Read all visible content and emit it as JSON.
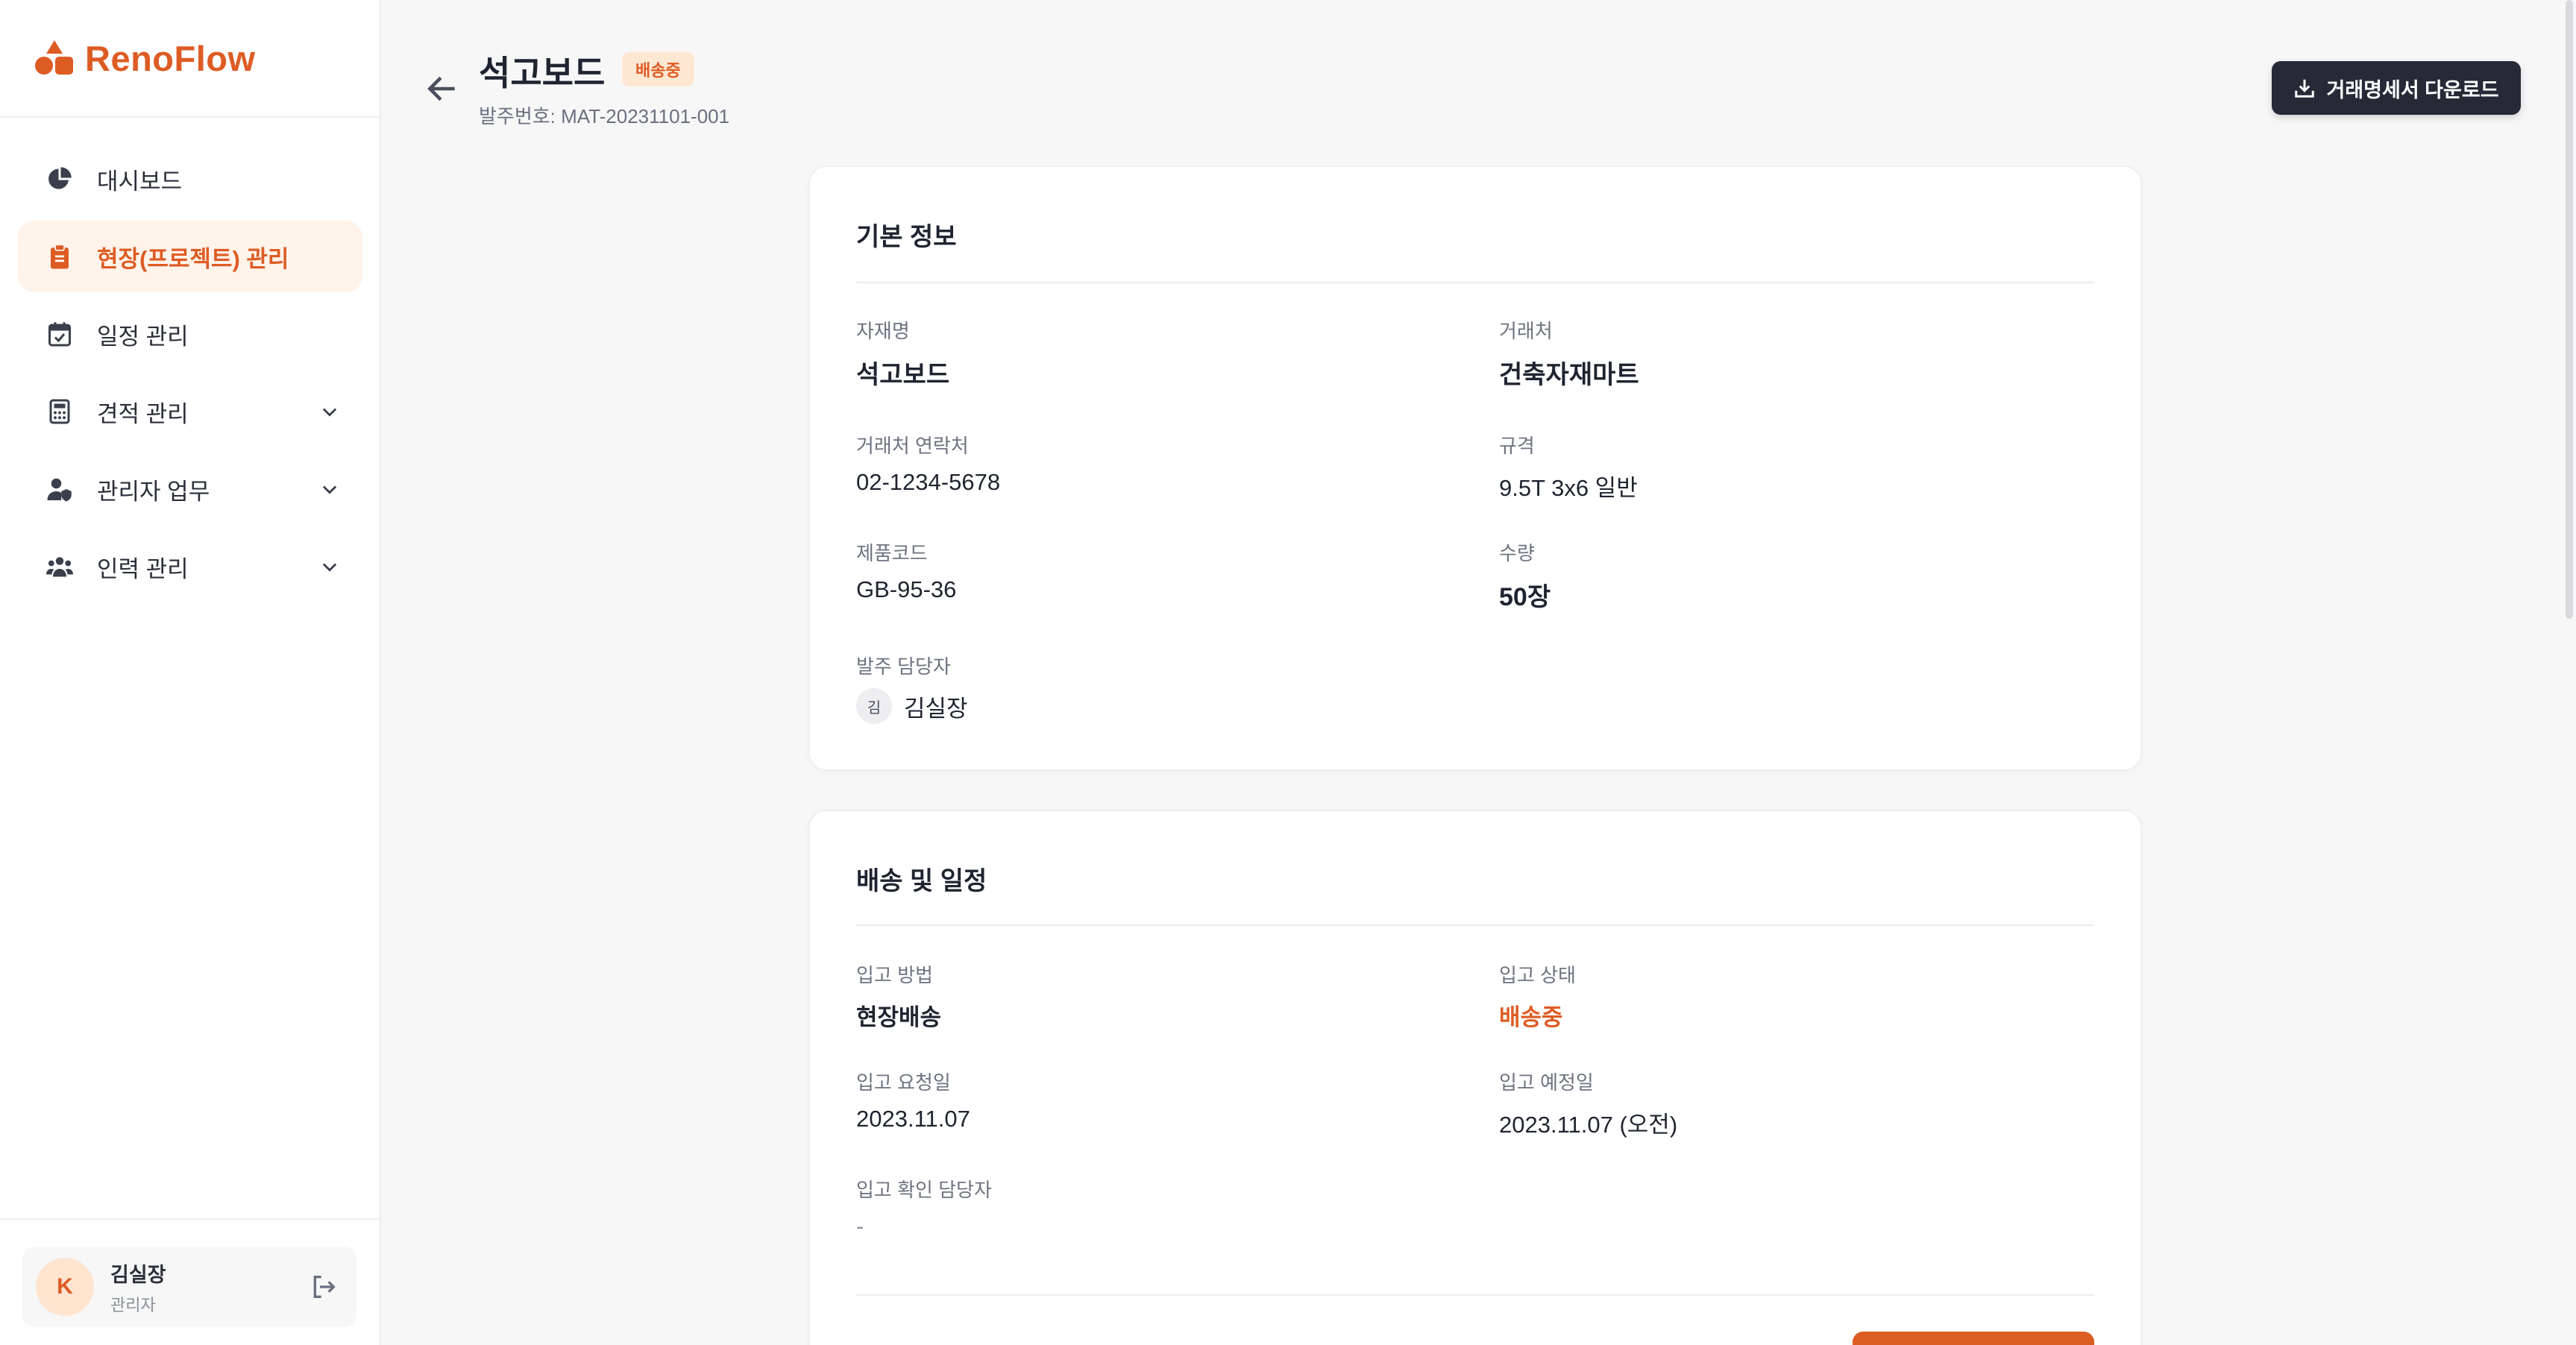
{
  "brand": {
    "name": "RenoFlow"
  },
  "nav": [
    {
      "label": "대시보드",
      "icon": "pie-chart-icon"
    },
    {
      "label": "현장(프로젝트) 관리",
      "icon": "clipboard-icon",
      "active": true
    },
    {
      "label": "일정 관리",
      "icon": "calendar-check-icon"
    },
    {
      "label": "견적 관리",
      "icon": "calculator-icon",
      "expandable": true
    },
    {
      "label": "관리자 업무",
      "icon": "user-shield-icon",
      "expandable": true
    },
    {
      "label": "인력 관리",
      "icon": "users-icon",
      "expandable": true
    }
  ],
  "user": {
    "initial": "K",
    "name": "김실장",
    "role": "관리자"
  },
  "header": {
    "title": "석고보드",
    "status_badge": "배송중",
    "order_number": "발주번호: MAT-20231101-001",
    "download_label": "거래명세서 다운로드"
  },
  "basic_info": {
    "title": "기본 정보",
    "material_label": "자재명",
    "material_value": "석고보드",
    "vendor_label": "거래처",
    "vendor_value": "건축자재마트",
    "vendor_contact_label": "거래처 연락처",
    "vendor_contact_value": "02-1234-5678",
    "spec_label": "규격",
    "spec_value": "9.5T 3x6 일반",
    "product_code_label": "제품코드",
    "product_code_value": "GB-95-36",
    "quantity_label": "수량",
    "quantity_value": "50장",
    "manager_label": "발주 담당자",
    "manager_initial": "김",
    "manager_value": "김실장"
  },
  "delivery": {
    "title": "배송 및 일정",
    "method_label": "입고 방법",
    "method_value": "현장배송",
    "status_label": "입고 상태",
    "status_value": "배송중",
    "request_date_label": "입고 요청일",
    "request_date_value": "2023.11.07",
    "expected_date_label": "입고 예정일",
    "expected_date_value": "2023.11.07 (오전)",
    "confirm_label": "입고 확인 담당자",
    "confirm_value": "-"
  },
  "colors": {
    "accent": "#dd5c24",
    "dark_button": "#252a36",
    "badge_bg": "#ffe8d3"
  }
}
